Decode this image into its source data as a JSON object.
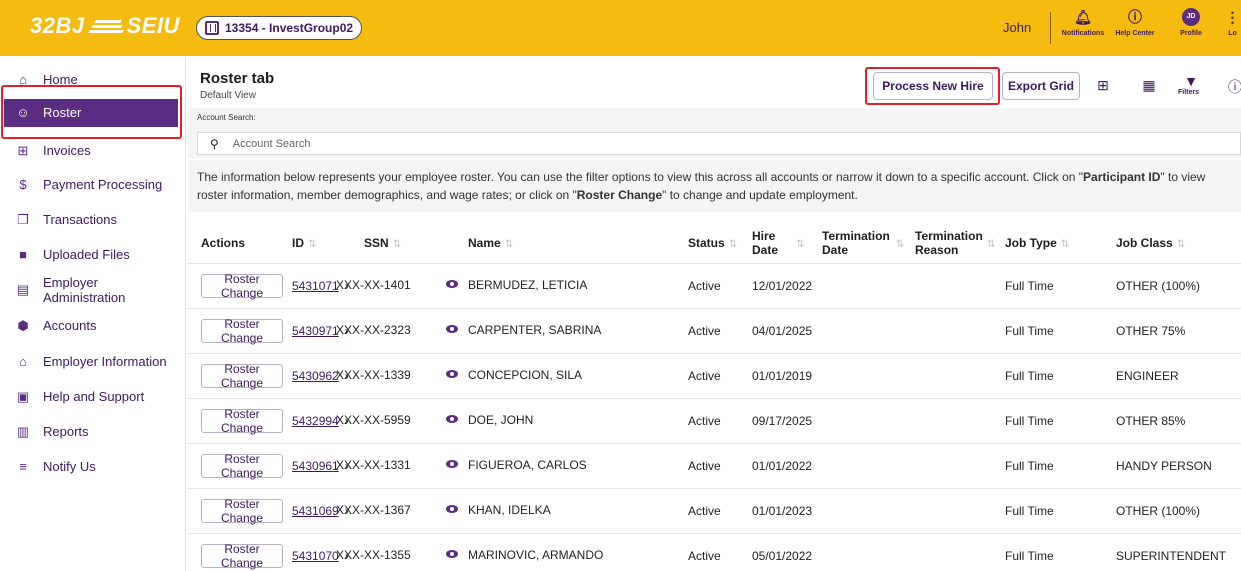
{
  "header": {
    "logo_left": "32BJ",
    "logo_right": "SEIU",
    "account": "13354 - InvestGroup02",
    "user": "John",
    "notifications": "Notifications",
    "help_center": "Help Center",
    "profile": "Profile",
    "profile_initials": "JD",
    "logout_partial": "Lo",
    "brand_color": "#f5bb0e",
    "accent_color": "#5a2d82"
  },
  "sidebar": {
    "items": [
      {
        "label": "Home",
        "icon": "home-icon"
      },
      {
        "label": "Roster",
        "icon": "people-icon",
        "active": true
      },
      {
        "label": "Invoices",
        "icon": "plus-box-icon"
      },
      {
        "label": "Payment Processing",
        "icon": "dollar-icon"
      },
      {
        "label": "Transactions",
        "icon": "copy-icon"
      },
      {
        "label": "Uploaded Files",
        "icon": "folder-icon"
      },
      {
        "label": "Employer",
        "label2": "Administration",
        "icon": "clipboard-icon"
      },
      {
        "label": "Accounts",
        "icon": "hexagon-icon"
      },
      {
        "label": "Employer Information",
        "icon": "bank-icon"
      },
      {
        "label": "Help and Support",
        "icon": "chat-icon"
      },
      {
        "label": "Reports",
        "icon": "report-icon"
      },
      {
        "label": "Notify Us",
        "icon": "list-check-icon"
      }
    ]
  },
  "main": {
    "title": "Roster tab",
    "subtitle": "Default View",
    "process_new_hire": "Process New Hire",
    "export_grid": "Export Grid",
    "filters_label": "Filters",
    "search_label": "Account Search:",
    "search_placeholder": "Account Search",
    "info": {
      "part1": "The information below represents your employee roster. You can use the filter options to view this across all accounts or narrow it down to a specific account. Click on \"",
      "bold1": "Participant ID",
      "part2": "\" to view roster information, member demographics, and wage rates; or click on \"",
      "bold2": "Roster Change",
      "part3": "\" to change and update employment."
    }
  },
  "table": {
    "headers": {
      "actions": "Actions",
      "id": "ID",
      "ssn": "SSN",
      "name": "Name",
      "status": "Status",
      "hire_date_1": "Hire",
      "hire_date_2": "Date",
      "term_date_1": "Termination",
      "term_date_2": "Date",
      "term_reason_1": "Termination",
      "term_reason_2": "Reason",
      "job_type": "Job Type",
      "job_class": "Job Class"
    },
    "action_label": "Roster Change",
    "rows": [
      {
        "id": "5431071",
        "ssn": "XXX-XX-1401",
        "name": "BERMUDEZ, LETICIA",
        "status": "Active",
        "hire": "12/01/2022",
        "job_type": "Full Time",
        "job_class": "OTHER (100%)"
      },
      {
        "id": "5430971",
        "ssn": "XXX-XX-2323",
        "name": "CARPENTER, SABRINA",
        "status": "Active",
        "hire": "04/01/2025",
        "job_type": "Full Time",
        "job_class": "OTHER 75%"
      },
      {
        "id": "5430962",
        "ssn": "XXX-XX-1339",
        "name": "CONCEPCION, SILA",
        "status": "Active",
        "hire": "01/01/2019",
        "job_type": "Full Time",
        "job_class": "ENGINEER"
      },
      {
        "id": "5432994",
        "ssn": "XXX-XX-5959",
        "name": "DOE, JOHN",
        "status": "Active",
        "hire": "09/17/2025",
        "job_type": "Full Time",
        "job_class": "OTHER 85%"
      },
      {
        "id": "5430961",
        "ssn": "XXX-XX-1331",
        "name": "FIGUEROA, CARLOS",
        "status": "Active",
        "hire": "01/01/2022",
        "job_type": "Full Time",
        "job_class": "HANDY PERSON"
      },
      {
        "id": "5431069",
        "ssn": "XXX-XX-1367",
        "name": "KHAN, IDELKA",
        "status": "Active",
        "hire": "01/01/2023",
        "job_type": "Full Time",
        "job_class": "OTHER (100%)"
      },
      {
        "id": "5431070",
        "ssn": "XXX-XX-1355",
        "name": "MARINOVIC, ARMANDO",
        "status": "Active",
        "hire": "05/01/2022",
        "job_type": "Full Time",
        "job_class": "SUPERINTENDENT"
      }
    ]
  }
}
